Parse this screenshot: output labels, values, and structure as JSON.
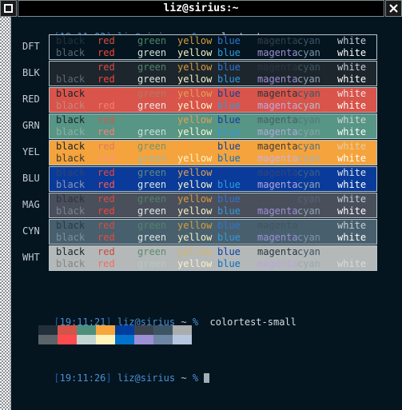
{
  "window": {
    "title": "liz@sirius:~",
    "menu_icon": "maximize-icon",
    "close_icon": "close-icon"
  },
  "terminal": {
    "bg": "#04151f",
    "fg": "#d5dde2",
    "prompt_user": "liz@sirius",
    "prompt_cwd": "~",
    "prompt_sigil": "%"
  },
  "lines": [
    {
      "kind": "prompt",
      "time": "19:11:02",
      "command": "colortest"
    },
    {
      "kind": "prompt",
      "time": "19:11:21",
      "command": "colortest-small"
    },
    {
      "kind": "prompt",
      "time": "19:11:26",
      "command": ""
    }
  ],
  "colortest": {
    "column_names": [
      "black",
      "red",
      "green",
      "yellow",
      "blue",
      "magenta",
      "cyan",
      "white"
    ],
    "row_labels": [
      "DFT",
      "BLK",
      "RED",
      "GRN",
      "YEL",
      "BLU",
      "MAG",
      "CYN",
      "WHT"
    ],
    "rows": [
      {
        "label": "DFT",
        "bg": "#04151f",
        "dim": [
          "#1f3240",
          "#d84b43",
          "#4e8468",
          "#d99b3a",
          "#2f74d0",
          "#33404d",
          "#3e5563",
          "#c5ced4"
        ],
        "bright": [
          "#5a6b76",
          "#f1453c",
          "#d5e0de",
          "#f6f2c4",
          "#2f9be0",
          "#9d8fd6",
          "#7f93a8",
          "#ffffff"
        ]
      },
      {
        "label": "BLK",
        "bg": "#1d262d",
        "dim": [
          "#1d262d",
          "#d84b43",
          "#4e8468",
          "#d99b3a",
          "#2f74d0",
          "#2b3540",
          "#3e5563",
          "#c5ced4"
        ],
        "bright": [
          "#5a6b76",
          "#f1453c",
          "#dfe8e6",
          "#f6f2c4",
          "#2f9be0",
          "#9d8fd6",
          "#8fa2b4",
          "#ffffff"
        ]
      },
      {
        "label": "RED",
        "bg": "#d9544a",
        "dim": [
          "#16242e",
          "#d9544a",
          "#b07a62",
          "#e0a252",
          "#0b3ea1",
          "#2b3540",
          "#39566b",
          "#efe6e4"
        ],
        "bright": [
          "#c4867e",
          "#f57e76",
          "#e6eeec",
          "#fdf6cd",
          "#2f9be0",
          "#bfa9e2",
          "#b2bec8",
          "#ffffff"
        ]
      },
      {
        "label": "GRN",
        "bg": "#579584",
        "dim": [
          "#16242e",
          "#cf5a4f",
          "#579584",
          "#e0a252",
          "#0b3ea1",
          "#455f68",
          "#4d7b82",
          "#cdd8d6"
        ],
        "bright": [
          "#8fb0a6",
          "#f87f75",
          "#cfdfda",
          "#fdf6cd",
          "#2f9be0",
          "#b5a6dd",
          "#86a3a8",
          "#ffffff"
        ]
      },
      {
        "label": "YEL",
        "bg": "#f5a33c",
        "dim": [
          "#16242e",
          "#e07b63",
          "#6f9471",
          "#f5a33c",
          "#0b3ea1",
          "#3e3c3a",
          "#58707a",
          "#e4cfa4"
        ],
        "bright": [
          "#3c3a33",
          "#fb9383",
          "#9fb8a6",
          "#fdf6cd",
          "#0d6fc0",
          "#c5b2e4",
          "#9fb2b9",
          "#ffffff"
        ]
      },
      {
        "label": "BLU",
        "bg": "#0a3b9a",
        "dim": [
          "#2b4375",
          "#e4483e",
          "#5e8a7f",
          "#e0a252",
          "#0a3b9a",
          "#33427e",
          "#3e5e84",
          "#dfe5ec"
        ],
        "bright": [
          "#8b96b8",
          "#fb5a50",
          "#dae6e4",
          "#fdf6cd",
          "#2f9be0",
          "#b5a6dd",
          "#8fa2b4",
          "#ffffff"
        ]
      },
      {
        "label": "MAG",
        "bg": "#4a4f5c",
        "dim": [
          "#2c3240",
          "#d84b43",
          "#4e8468",
          "#d99b3a",
          "#2f74d0",
          "#4a4f5c",
          "#566272",
          "#c5ced4"
        ],
        "bright": [
          "#7b8490",
          "#f1453c",
          "#dfe8e6",
          "#f6f2c4",
          "#2f9be0",
          "#9d8fd6",
          "#8fa2b4",
          "#ffffff"
        ]
      },
      {
        "label": "CYN",
        "bg": "#48606e",
        "dim": [
          "#263b47",
          "#d84b43",
          "#4e8468",
          "#d99b3a",
          "#2f74d0",
          "#44525f",
          "#48606e",
          "#c5ced4"
        ],
        "bright": [
          "#7d8f9a",
          "#f1453c",
          "#dfe8e6",
          "#f6f2c4",
          "#2f9be0",
          "#9d8fd6",
          "#7f93a8",
          "#ffffff"
        ]
      },
      {
        "label": "WHT",
        "bg": "#b4b8b8",
        "dim": [
          "#16242e",
          "#d0463d",
          "#5a8a70",
          "#d9b463",
          "#0b3ea1",
          "#2b3540",
          "#3e5563",
          "#b4b8b8"
        ],
        "bright": [
          "#7e8688",
          "#f56b62",
          "#b6c8c1",
          "#f6f2c4",
          "#0d6fc0",
          "#b7a6de",
          "#9aa9b2",
          "#d6dbdb"
        ]
      }
    ]
  },
  "colortest_small": {
    "dim": [
      "#22303a",
      "#d35448",
      "#4e8f7c",
      "#f6a63c",
      "#013d9e",
      "#3d4450",
      "#3d5464",
      "#aaadae"
    ],
    "bright": [
      "#5a646a",
      "#fe4b50",
      "#c2d5d3",
      "#fcf4bb",
      "#0272cb",
      "#9d8fd6",
      "#6e86a3",
      "#b6c6de"
    ]
  }
}
